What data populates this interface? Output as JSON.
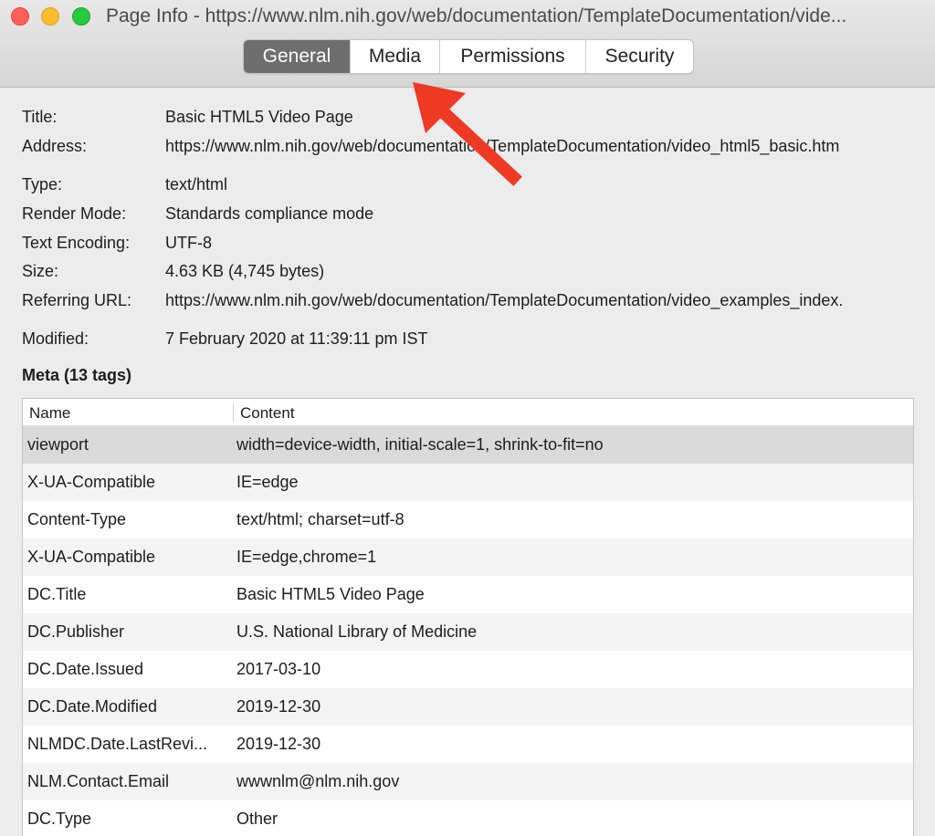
{
  "window": {
    "title": "Page Info - https://www.nlm.nih.gov/web/documentation/TemplateDocumentation/vide..."
  },
  "tabs": [
    {
      "label": "General",
      "active": true
    },
    {
      "label": "Media",
      "active": false
    },
    {
      "label": "Permissions",
      "active": false
    },
    {
      "label": "Security",
      "active": false
    }
  ],
  "info": {
    "title": {
      "label": "Title:",
      "value": "Basic HTML5 Video Page"
    },
    "address": {
      "label": "Address:",
      "value": "https://www.nlm.nih.gov/web/documentation/TemplateDocumentation/video_html5_basic.htm"
    },
    "type": {
      "label": "Type:",
      "value": "text/html"
    },
    "render_mode": {
      "label": "Render Mode:",
      "value": "Standards compliance mode"
    },
    "text_encoding": {
      "label": "Text Encoding:",
      "value": "UTF-8"
    },
    "size": {
      "label": "Size:",
      "value": "4.63 KB (4,745 bytes)"
    },
    "referring_url": {
      "label": "Referring URL:",
      "value": "https://www.nlm.nih.gov/web/documentation/TemplateDocumentation/video_examples_index."
    },
    "modified": {
      "label": "Modified:",
      "value": "7 February 2020 at 11:39:11 pm IST"
    }
  },
  "meta": {
    "heading": "Meta (13 tags)",
    "columns": {
      "name": "Name",
      "content": "Content"
    },
    "rows": [
      {
        "name": "viewport",
        "content": "width=device-width, initial-scale=1, shrink-to-fit=no"
      },
      {
        "name": "X-UA-Compatible",
        "content": "IE=edge"
      },
      {
        "name": "Content-Type",
        "content": "text/html; charset=utf-8"
      },
      {
        "name": "X-UA-Compatible",
        "content": "IE=edge,chrome=1"
      },
      {
        "name": "DC.Title",
        "content": "Basic HTML5 Video Page"
      },
      {
        "name": "DC.Publisher",
        "content": "U.S. National Library of Medicine"
      },
      {
        "name": "DC.Date.Issued",
        "content": "2017-03-10"
      },
      {
        "name": "DC.Date.Modified",
        "content": "2019-12-30"
      },
      {
        "name": "NLMDC.Date.LastRevi...",
        "content": "2019-12-30"
      },
      {
        "name": "NLM.Contact.Email",
        "content": "wwwnlm@nlm.nih.gov"
      },
      {
        "name": "DC.Type",
        "content": "Other"
      }
    ]
  },
  "colors": {
    "arrow": "#ee3a23",
    "active_tab": "#6e6e6e",
    "selected_row": "#dadada"
  }
}
